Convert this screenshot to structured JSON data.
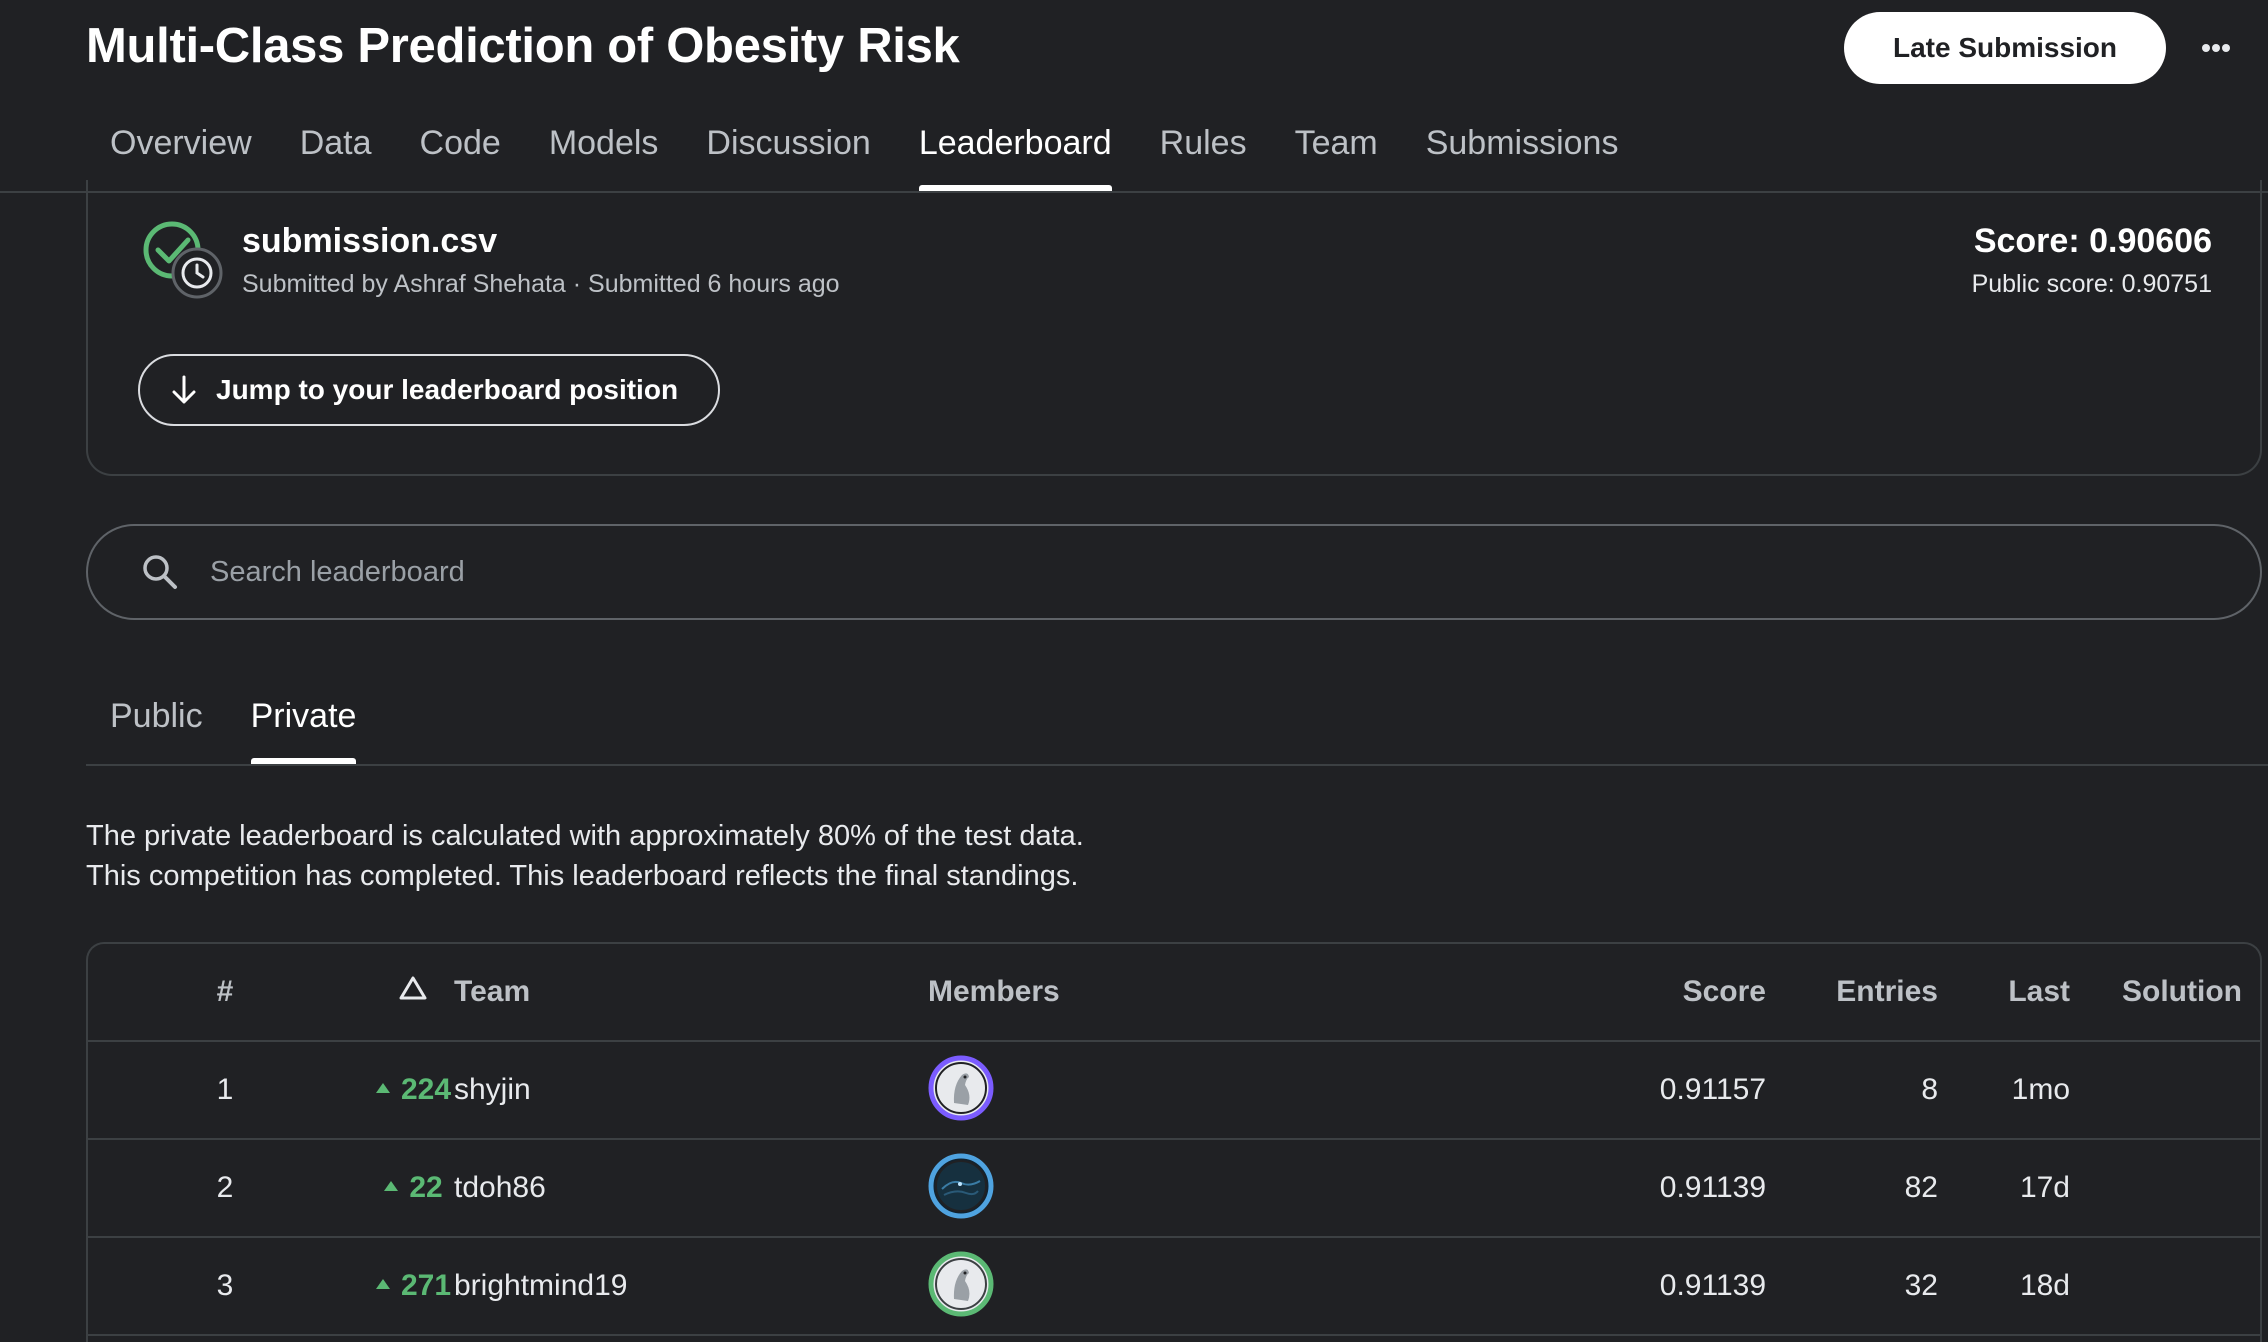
{
  "header": {
    "title": "Multi-Class Prediction of Obesity Risk",
    "late_submission_label": "Late Submission",
    "more_icon": "more-horizontal-icon",
    "tabs": [
      {
        "label": "Overview"
      },
      {
        "label": "Data"
      },
      {
        "label": "Code"
      },
      {
        "label": "Models"
      },
      {
        "label": "Discussion"
      },
      {
        "label": "Leaderboard",
        "active": true
      },
      {
        "label": "Rules"
      },
      {
        "label": "Team"
      },
      {
        "label": "Submissions"
      }
    ]
  },
  "submission": {
    "file_name": "submission.csv",
    "meta": "Submitted by Ashraf Shehata · Submitted 6 hours ago",
    "score": "Score: 0.90606",
    "public_score": "Public score: 0.90751",
    "jump_label": "Jump to your leaderboard position",
    "status_icon": "check-circle-clock-icon"
  },
  "search": {
    "placeholder": "Search leaderboard"
  },
  "board_tabs": [
    {
      "label": "Public"
    },
    {
      "label": "Private",
      "active": true
    }
  ],
  "note": {
    "line1": "The private leaderboard is calculated with approximately 80% of the test data.",
    "line2": "This competition has completed. This leaderboard reflects the final standings."
  },
  "table": {
    "columns": {
      "rank": "#",
      "team": "Team",
      "members": "Members",
      "score": "Score",
      "entries": "Entries",
      "last": "Last",
      "solution": "Solution"
    },
    "rows": [
      {
        "rank": "1",
        "delta": "224",
        "team": "shyjin",
        "score": "0.91157",
        "entries": "8",
        "last": "1mo",
        "avatar_ring": "#7b5cff"
      },
      {
        "rank": "2",
        "delta": "22",
        "team": "tdoh86",
        "score": "0.91139",
        "entries": "82",
        "last": "17d",
        "avatar_ring": "#4fa3e0"
      },
      {
        "rank": "3",
        "delta": "271",
        "team": "brightmind19",
        "score": "0.91139",
        "entries": "32",
        "last": "18d",
        "avatar_ring": "#5bb974"
      }
    ]
  },
  "colors": {
    "background": "#202124",
    "positive_delta": "#5bb974",
    "success_check": "#5bb974"
  }
}
